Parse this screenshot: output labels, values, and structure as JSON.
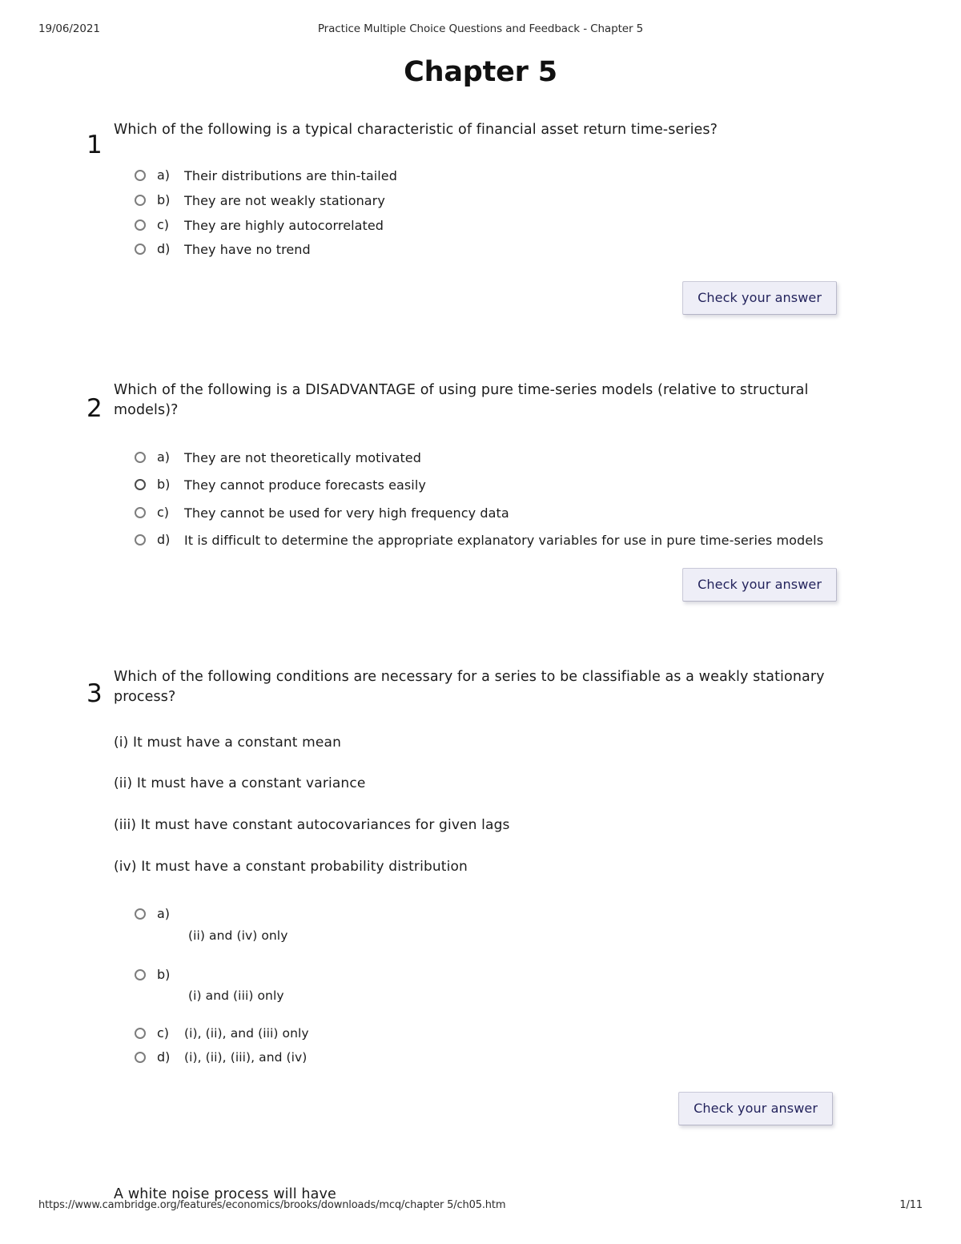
{
  "print_header": {
    "date": "19/06/2021",
    "title": "Practice Multiple Choice Questions and Feedback - Chapter 5"
  },
  "doc_title": "Chapter 5",
  "questions": [
    {
      "number": "1",
      "text": "Which of the following is a typical characteristic of financial asset return time-series?",
      "options": [
        {
          "letter": "a)",
          "text": "Their distributions are thin-tailed"
        },
        {
          "letter": "b)",
          "text": "They are not weakly stationary"
        },
        {
          "letter": "c)",
          "text": "They are highly autocorrelated"
        },
        {
          "letter": "d)",
          "text": "They have no trend"
        }
      ],
      "check_label": "Check your answer"
    },
    {
      "number": "2",
      "text": "Which of the following is a DISADVANTAGE of using pure time-series models (relative to structural models)?",
      "options": [
        {
          "letter": "a)",
          "text": "They are not theoretically motivated"
        },
        {
          "letter": "b)",
          "text": "They cannot produce forecasts easily"
        },
        {
          "letter": "c)",
          "text": "They cannot be used for very high frequency data"
        },
        {
          "letter": "d)",
          "text": "It is difficult to determine the appropriate explanatory variables for use in pure time-series models"
        }
      ],
      "check_label": "Check your answer"
    },
    {
      "number": "3",
      "text": "Which of the following conditions are necessary for a series to be classifiable as a weakly stationary process?",
      "statements": [
        "(i) It must have a constant mean",
        "(ii) It must have a constant variance",
        "(iii) It must have constant autocovariances for given lags",
        "(iv) It must have a constant probability distribution"
      ],
      "options": [
        {
          "letter": "a)",
          "text": "(ii) and (iv) only"
        },
        {
          "letter": "b)",
          "text": "(i) and (iii) only"
        },
        {
          "letter": "c)",
          "text": "(i), (ii), and (iii) only"
        },
        {
          "letter": "d)",
          "text": "(i), (ii), (iii), and (iv)"
        }
      ],
      "check_label": "Check your answer"
    }
  ],
  "trailing_question_text": "A white noise process will have",
  "print_footer": {
    "url": "https://www.cambridge.org/features/economics/brooks/downloads/mcq/chapter 5/ch05.htm",
    "page": "1/11"
  }
}
